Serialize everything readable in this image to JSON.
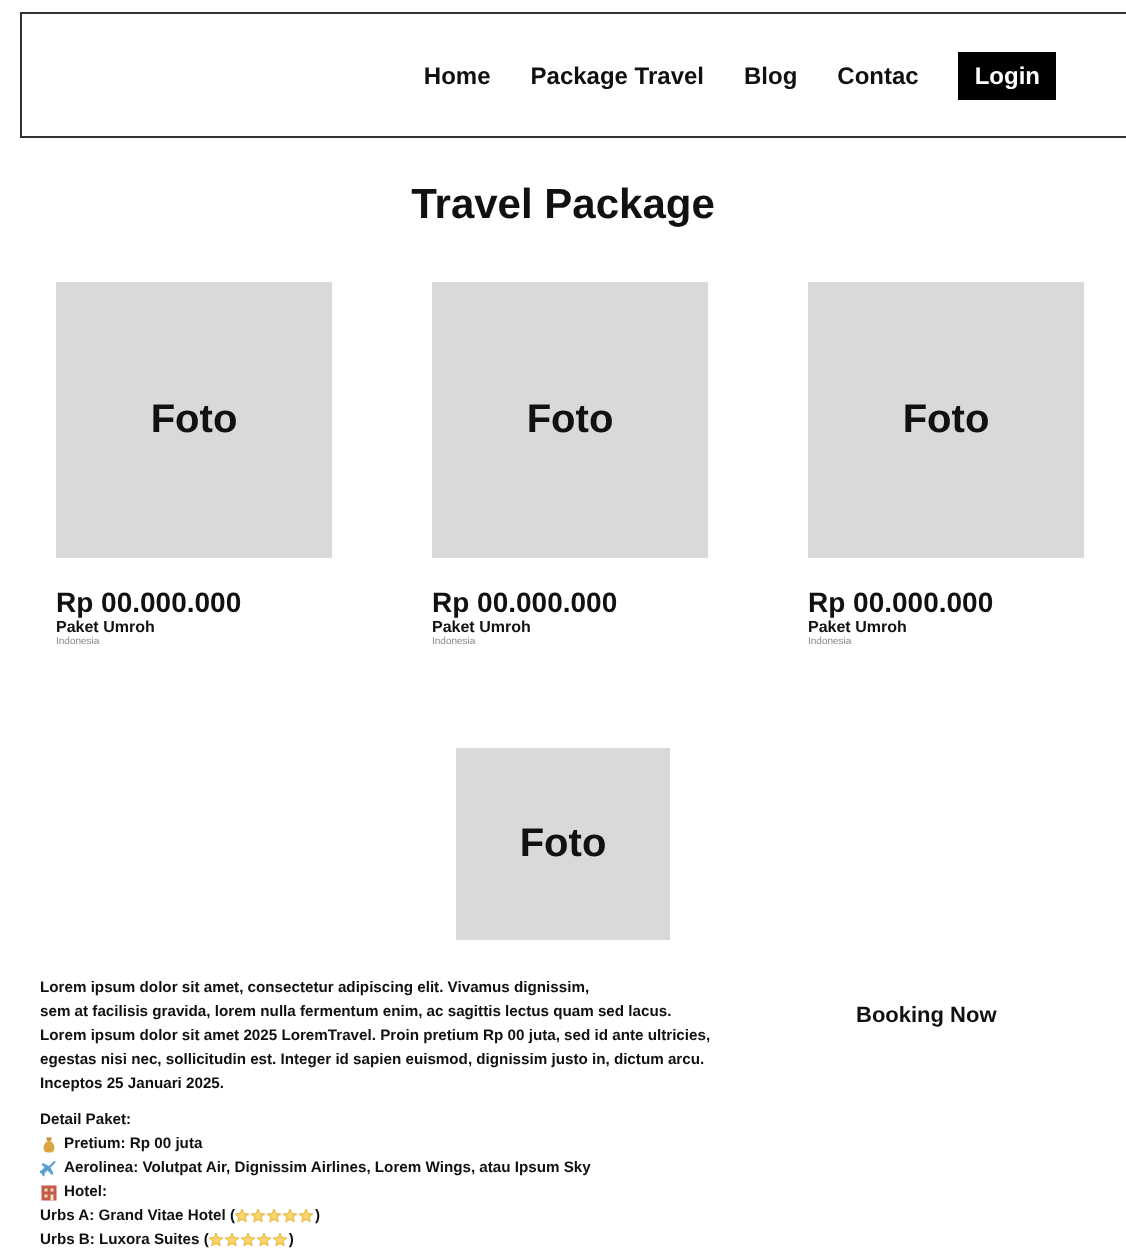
{
  "nav": {
    "items": [
      {
        "label": "Home"
      },
      {
        "label": "Package Travel"
      },
      {
        "label": "Blog"
      },
      {
        "label": "Contac"
      }
    ],
    "login": "Login"
  },
  "title": "Travel Package",
  "packages": [
    {
      "photo": "Foto",
      "price": "Rp 00.000.000",
      "name": "Paket Umroh",
      "location": "Indonesia"
    },
    {
      "photo": "Foto",
      "price": "Rp 00.000.000",
      "name": "Paket Umroh",
      "location": "Indonesia"
    },
    {
      "photo": "Foto",
      "price": "Rp 00.000.000",
      "name": "Paket Umroh",
      "location": "Indonesia"
    }
  ],
  "detail": {
    "photo": "Foto",
    "description": [
      "Lorem ipsum dolor sit amet, consectetur adipiscing elit. Vivamus dignissim,",
      "sem at facilisis gravida, lorem nulla fermentum enim, ac sagittis lectus quam sed lacus.",
      "Lorem ipsum dolor sit amet 2025 LoremTravel. Proin pretium Rp 00 juta, sed id ante ultricies,",
      "egestas nisi nec, sollicitudin est. Integer id sapien euismod, dignissim justo in, dictum arcu.",
      "Inceptos 25 Januari 2025."
    ],
    "booking": "Booking Now",
    "heading": "Detail Paket:",
    "items": [
      {
        "kind": "money",
        "text": "Pretium: Rp 00 juta"
      },
      {
        "kind": "plane",
        "text": "Aerolinea: Volutpat Air, Dignissim Airlines, Lorem Wings, atau Ipsum Sky"
      },
      {
        "kind": "hotel",
        "text": "Hotel:"
      }
    ],
    "hotels": [
      {
        "name": "Urbs A: Grand Vitae Hotel (",
        "stars": 5,
        "close": ")"
      },
      {
        "name": "Urbs B: Luxora Suites (",
        "stars": 5,
        "close": ")"
      }
    ]
  }
}
